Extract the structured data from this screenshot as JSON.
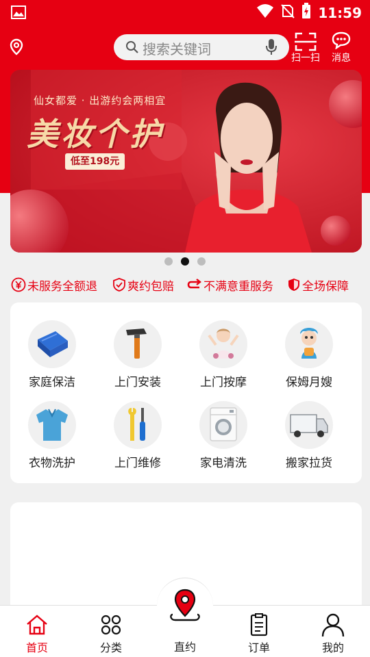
{
  "status_bar": {
    "time": "11:59"
  },
  "header": {
    "search_placeholder": "搜索关键词",
    "scan_label": "扫一扫",
    "message_label": "消息"
  },
  "banner": {
    "subtitle": "仙女都爱 · 出游约会两相宜",
    "title": "美妆个护",
    "price_tag": "低至198元",
    "slide_count": 3,
    "active_slide": 2
  },
  "guarantees": [
    {
      "label": "未服务全额退",
      "icon": "yen-circle-icon"
    },
    {
      "label": "爽约包赔",
      "icon": "shield-check-icon"
    },
    {
      "label": "不满意重服务",
      "icon": "redo-arrow-icon"
    },
    {
      "label": "全场保障",
      "icon": "shield-half-icon"
    }
  ],
  "services": [
    {
      "label": "家庭保洁",
      "icon": "towel-icon"
    },
    {
      "label": "上门安装",
      "icon": "hammer-icon"
    },
    {
      "label": "上门按摩",
      "icon": "massage-girl-icon"
    },
    {
      "label": "保姆月嫂",
      "icon": "nanny-icon"
    },
    {
      "label": "衣物洗护",
      "icon": "shirt-icon"
    },
    {
      "label": "上门维修",
      "icon": "tools-icon"
    },
    {
      "label": "家电清洗",
      "icon": "washing-machine-icon"
    },
    {
      "label": "搬家拉货",
      "icon": "truck-icon"
    }
  ],
  "bottom_nav": [
    {
      "label": "首页",
      "icon": "home-icon",
      "active": true
    },
    {
      "label": "分类",
      "icon": "category-icon",
      "active": false
    },
    {
      "label": "直约",
      "icon": "location-pin-icon",
      "active": false
    },
    {
      "label": "订单",
      "icon": "order-list-icon",
      "active": false
    },
    {
      "label": "我的",
      "icon": "user-icon",
      "active": false
    }
  ],
  "colors": {
    "brand_red": "#e60012",
    "page_bg": "#f0f0f0"
  }
}
